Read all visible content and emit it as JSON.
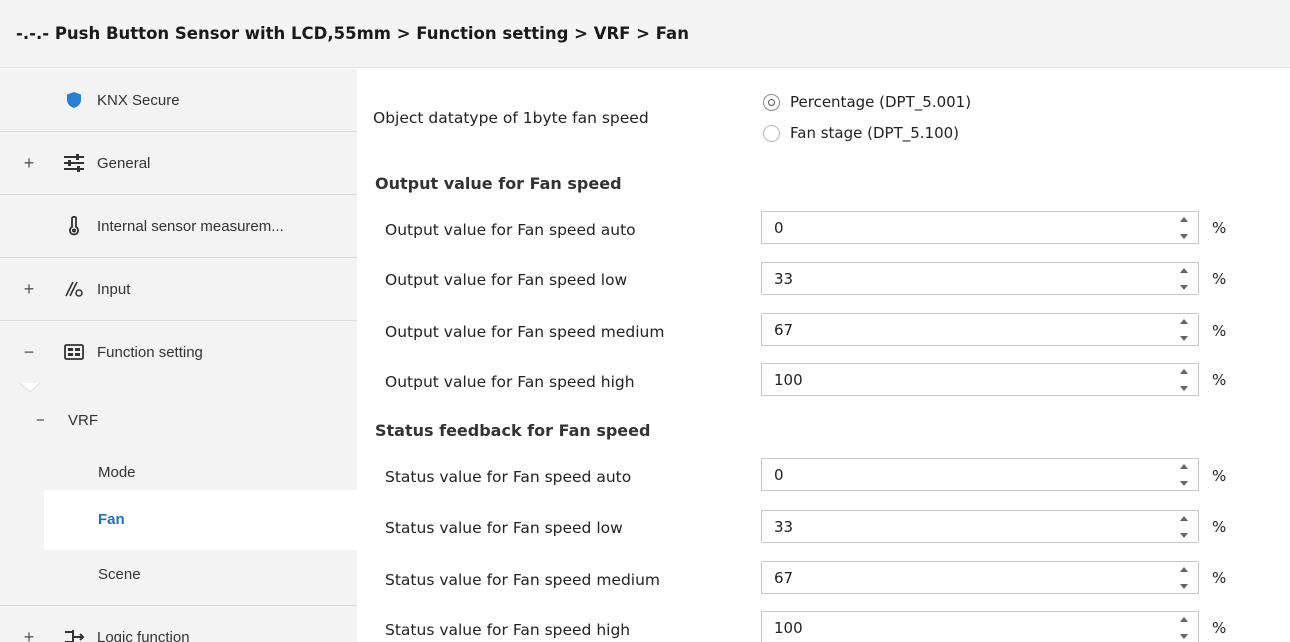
{
  "title": "-.-.- Push Button Sensor with LCD,55mm > Function setting > VRF > Fan",
  "sidebar": {
    "items": [
      {
        "label": "KNX Secure",
        "expander": "",
        "icon": "shield-icon"
      },
      {
        "label": "General",
        "expander": "+",
        "icon": "sliders-icon"
      },
      {
        "label": "Internal sensor measurem...",
        "expander": "",
        "icon": "thermometer-icon"
      },
      {
        "label": "Input",
        "expander": "+",
        "icon": "input-icon"
      },
      {
        "label": "Function setting",
        "expander": "−",
        "icon": "grid-icon"
      },
      {
        "label": "Logic function",
        "expander": "+",
        "icon": "logic-icon"
      }
    ],
    "vrf": {
      "label": "VRF",
      "expander": "−"
    },
    "sub": [
      {
        "label": "Mode"
      },
      {
        "label": "Fan"
      },
      {
        "label": "Scene"
      }
    ]
  },
  "main": {
    "datatype": {
      "label": "Object datatype of 1byte fan speed",
      "options": [
        "Percentage (DPT_5.001)",
        "Fan stage (DPT_5.100)"
      ],
      "selected": "Percentage (DPT_5.001)"
    },
    "output_section": "Output value for Fan speed",
    "output_rows": [
      {
        "label": "Output value for Fan speed auto",
        "value": "0",
        "unit": "%"
      },
      {
        "label": "Output value for Fan speed low",
        "value": "33",
        "unit": "%"
      },
      {
        "label": "Output value for Fan speed medium",
        "value": "67",
        "unit": "%"
      },
      {
        "label": "Output value for Fan speed high",
        "value": "100",
        "unit": "%"
      }
    ],
    "status_section": "Status feedback for Fan speed",
    "status_rows": [
      {
        "label": "Status value for Fan speed auto",
        "value": "0",
        "unit": "%"
      },
      {
        "label": "Status value for Fan speed low",
        "value": "33",
        "unit": "%"
      },
      {
        "label": "Status value for Fan speed medium",
        "value": "67",
        "unit": "%"
      },
      {
        "label": "Status value for Fan speed high",
        "value": "100",
        "unit": "%"
      }
    ]
  },
  "colors": {
    "accent": "#1c6fc4",
    "shield": "#2a7fd4"
  }
}
